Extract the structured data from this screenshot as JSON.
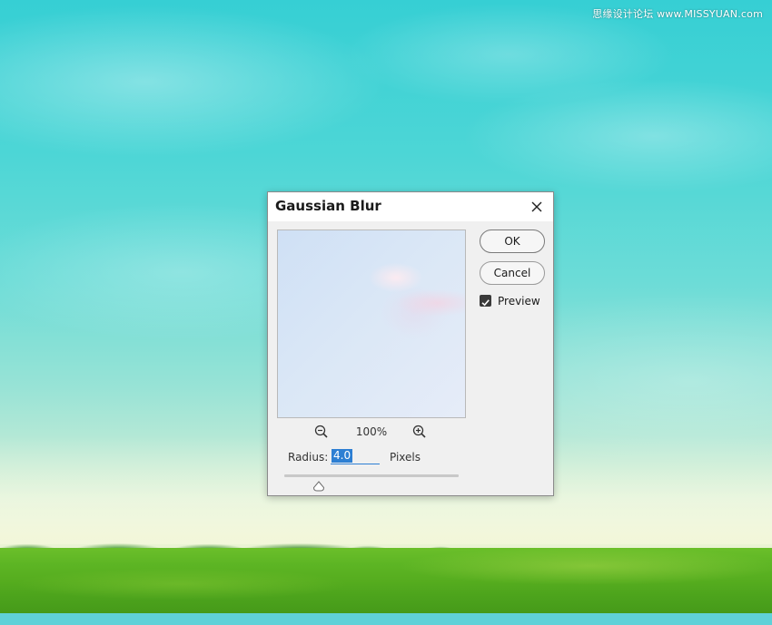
{
  "watermark": "思缘设计论坛 www.MISSYUAN.com",
  "dialog": {
    "title": "Gaussian Blur",
    "ok_label": "OK",
    "cancel_label": "Cancel",
    "preview_label": "Preview",
    "preview_checked": true,
    "zoom_level": "100%",
    "radius_label": "Radius:",
    "radius_value": "4.0",
    "units_label": "Pixels",
    "slider_fraction": 0.2
  },
  "icons": {
    "close": "close-icon",
    "zoom_out": "zoom-out-icon",
    "zoom_in": "zoom-in-icon",
    "check": "checkmark-icon",
    "slider_thumb": "slider-thumb-icon"
  },
  "colors": {
    "accent": "#2d7fd3",
    "dialog_bg": "#f0f0f0",
    "titlebar_bg": "#ffffff"
  }
}
